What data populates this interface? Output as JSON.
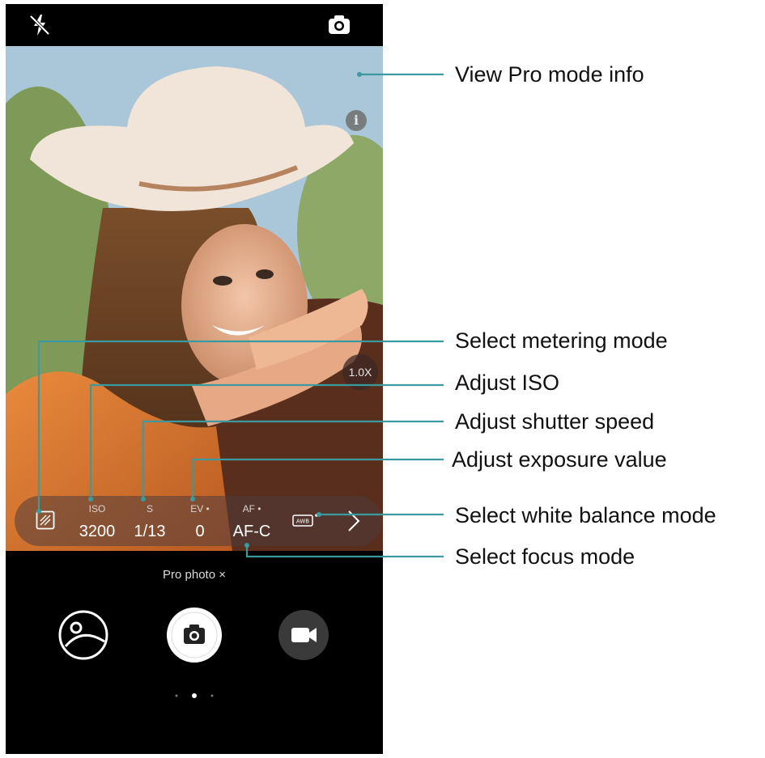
{
  "camera": {
    "info_glyph": "i",
    "zoom_level": "1.0X",
    "pro_controls": [
      {
        "key": "iso",
        "label": "ISO",
        "value": "3200"
      },
      {
        "key": "shutter",
        "label": "S",
        "value": "1/13"
      },
      {
        "key": "ev",
        "label": "EV •",
        "value": "0"
      },
      {
        "key": "af",
        "label": "AF •",
        "value": "AF-C"
      }
    ],
    "mode_label": "Pro photo ×",
    "icons": {
      "flash": "flash-off-icon",
      "switch": "camera-switch-icon",
      "metering": "metering-mode-icon",
      "white_balance": "awb-icon",
      "more": "chevron-right-icon",
      "gallery": "gallery-icon",
      "shutter": "shutter-button",
      "video": "video-icon"
    },
    "colors": {
      "accent": "#2a9d9c",
      "bar_bg": "#000000",
      "text_on_dark": "#ffffff"
    }
  },
  "annotations": {
    "view_info": "View Pro mode info",
    "metering": "Select metering mode",
    "iso": "Adjust ISO",
    "shutter": "Adjust shutter speed",
    "exposure": "Adjust exposure value",
    "white_balance": "Select white balance mode",
    "focus": "Select focus mode"
  }
}
